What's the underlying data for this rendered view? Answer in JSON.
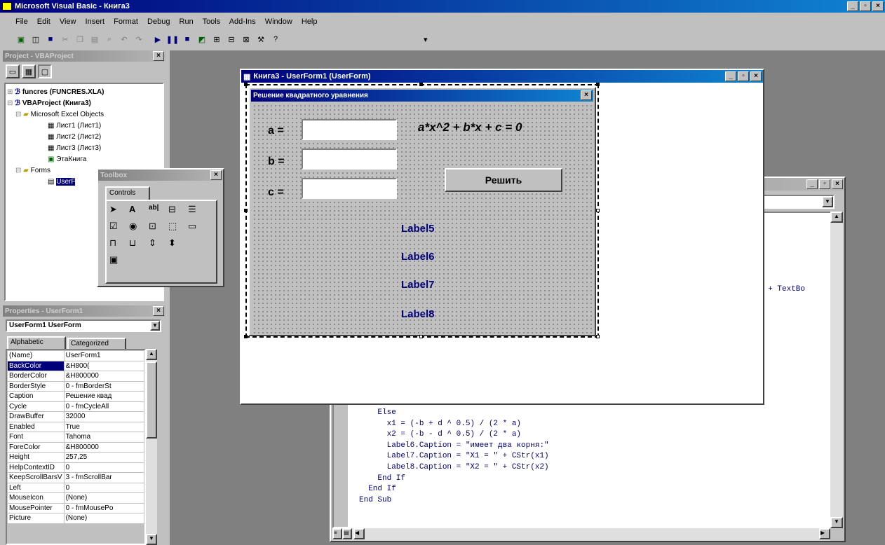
{
  "app": {
    "title": "Microsoft Visual Basic - Книга3",
    "menu": [
      "File",
      "Edit",
      "View",
      "Insert",
      "Format",
      "Debug",
      "Run",
      "Tools",
      "Add-Ins",
      "Window",
      "Help"
    ]
  },
  "project": {
    "title": "Project - VBAProject",
    "items": [
      "funcres (FUNCRES.XLA)",
      "VBAProject (Книга3)",
      "Microsoft Excel Objects",
      "Лист1 (Лист1)",
      "Лист2 (Лист2)",
      "Лист3 (Лист3)",
      "ЭтаКнига",
      "Forms",
      "UserF"
    ]
  },
  "toolbox": {
    "title": "Toolbox",
    "tab": "Controls",
    "tools": [
      "pointer",
      "label",
      "textbox",
      "combobox",
      "listbox",
      "checkbox",
      "option",
      "toggle",
      "frame",
      "commandbutton",
      "tabstrip",
      "multipage",
      "scrollbar",
      "spin",
      "image"
    ]
  },
  "properties": {
    "title": "Properties - UserForm1",
    "object": "UserForm1  UserForm",
    "tabs": [
      "Alphabetic",
      "Categorized"
    ],
    "rows": [
      [
        "(Name)",
        "UserForm1"
      ],
      [
        "BackColor",
        "&H800("
      ],
      [
        "BorderColor",
        "&H800000"
      ],
      [
        "BorderStyle",
        "0 - fmBorderSt"
      ],
      [
        "Caption",
        "Решение квад"
      ],
      [
        "Cycle",
        "0 - fmCycleAll"
      ],
      [
        "DrawBuffer",
        "32000"
      ],
      [
        "Enabled",
        "True"
      ],
      [
        "Font",
        "Tahoma"
      ],
      [
        "ForeColor",
        "&H800000"
      ],
      [
        "Height",
        "257,25"
      ],
      [
        "HelpContextID",
        "0"
      ],
      [
        "KeepScrollBarsV",
        "3 - fmScrollBar"
      ],
      [
        "Left",
        "0"
      ],
      [
        "MouseIcon",
        "(None)"
      ],
      [
        "MousePointer",
        "0 - fmMousePo"
      ],
      [
        "Picture",
        "(None)"
      ]
    ]
  },
  "designer": {
    "title": "Книга3 - UserForm1 (UserForm)"
  },
  "form": {
    "caption": "Решение квадратного уравнения",
    "label_a": "a =",
    "label_b": "b =",
    "label_c": "c =",
    "equation": "a*x^2 + b*x + c = 0",
    "solve_button": "Решить",
    "labels": [
      "Label5",
      "Label6",
      "Label7",
      "Label8"
    ]
  },
  "code": {
    "partial": "\" + TextBo",
    "lines": [
      "    Else",
      "      x1 = (-b + d ^ 0.5) / (2 * a)",
      "      x2 = (-b - d ^ 0.5) / (2 * a)",
      "      Label6.Caption = \"имеет два корня:\"",
      "      Label7.Caption = \"X1 = \" + CStr(x1)",
      "      Label8.Caption = \"X2 = \" + CStr(x2)",
      "    End If",
      "  End If",
      "End Sub"
    ]
  }
}
